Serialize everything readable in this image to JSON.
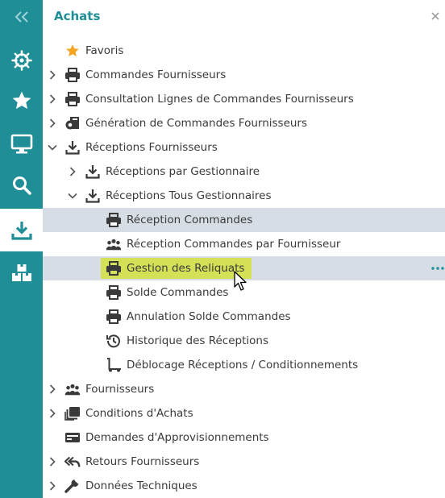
{
  "panel": {
    "title": "Achats"
  },
  "rail": {
    "items": [
      {
        "icon": "collapse-icon"
      },
      {
        "icon": "helm-icon"
      },
      {
        "icon": "star-icon"
      },
      {
        "icon": "monitor-icon"
      },
      {
        "icon": "search-icon"
      },
      {
        "icon": "download-icon",
        "active": true
      },
      {
        "icon": "boxes-icon"
      }
    ]
  },
  "tree": {
    "favoris": "Favoris",
    "commandes_fournisseurs": "Commandes Fournisseurs",
    "consultation_lignes": "Consultation Lignes de Commandes Fournisseurs",
    "generation_commandes": "Génération de Commandes Fournisseurs",
    "receptions_fournisseurs": "Réceptions Fournisseurs",
    "receptions_par_gestionnaire": "Réceptions par Gestionnaire",
    "receptions_tous_gestionnaires": "Réceptions Tous Gestionnaires",
    "reception_commandes": "Réception Commandes",
    "reception_commandes_par_fournisseur": "Réception Commandes par Fournisseur",
    "gestion_reliquats": "Gestion des Reliquats",
    "solde_commandes": "Solde Commandes",
    "annulation_solde": "Annulation Solde Commandes",
    "historique_receptions": "Historique des Réceptions",
    "deblocage_receptions": "Déblocage Réceptions / Conditionnements",
    "fournisseurs": "Fournisseurs",
    "conditions_achats": "Conditions d'Achats",
    "demandes_approvisionnements": "Demandes d'Approvisionnements",
    "retours_fournisseurs": "Retours Fournisseurs",
    "donnees_techniques": "Données Techniques"
  },
  "colors": {
    "accent": "#1f8e97",
    "highlight_row": "#d6dde4",
    "marker_yellow": "#d4e157",
    "star": "#f6a623"
  }
}
